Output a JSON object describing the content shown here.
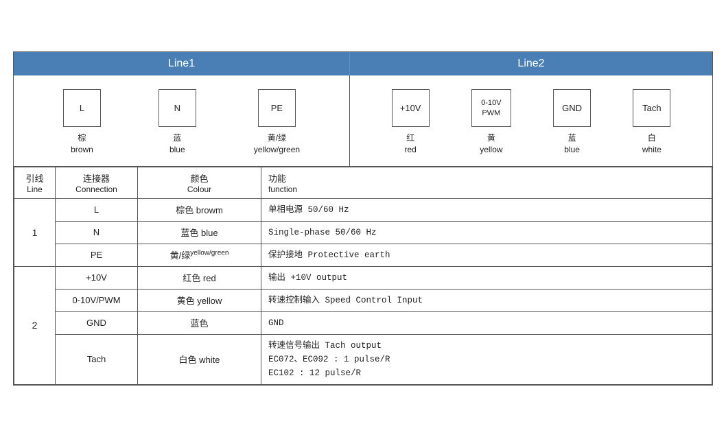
{
  "header": {
    "line1_label": "Line1",
    "line2_label": "Line2"
  },
  "diagram": {
    "line1_connectors": [
      {
        "label": "L",
        "zh": "棕",
        "en": "brown"
      },
      {
        "label": "N",
        "zh": "蓝",
        "en": "blue"
      },
      {
        "label": "PE",
        "zh": "黄/绿",
        "en": "yellow/green"
      }
    ],
    "line2_connectors": [
      {
        "label": "+10V",
        "zh": "红",
        "en": "red"
      },
      {
        "label": "0-10V\nPWM",
        "zh": "黄",
        "en": "yellow"
      },
      {
        "label": "GND",
        "zh": "蓝",
        "en": "blue"
      },
      {
        "label": "Tach",
        "zh": "白",
        "en": "white"
      }
    ]
  },
  "table": {
    "headers": {
      "line_zh": "引线",
      "line_en": "Line",
      "conn_zh": "连接器",
      "conn_en": "Connection",
      "colour_zh": "颜色",
      "colour_en": "Colour",
      "func_zh": "功能",
      "func_en": "function"
    },
    "rows": [
      {
        "line": "1",
        "line_rowspan": 3,
        "entries": [
          {
            "conn": "L",
            "colour_zh": "棕色",
            "colour_en": "browm",
            "func": "单相电源 50/60 Hz"
          },
          {
            "conn": "N",
            "colour_zh": "蓝色",
            "colour_en": "blue",
            "func": "Single-phase 50/60 Hz"
          },
          {
            "conn": "PE",
            "colour_zh": "黄/绿",
            "colour_en": "yellow/green",
            "func": "保护接地 Protective earth"
          }
        ]
      },
      {
        "line": "2",
        "line_rowspan": 4,
        "entries": [
          {
            "conn": "+10V",
            "colour_zh": "红色",
            "colour_en": "red",
            "func": "输出 +10V output"
          },
          {
            "conn": "0-10V/PWM",
            "colour_zh": "黄色",
            "colour_en": "yellow",
            "func": "转速控制输入 Speed Control Input"
          },
          {
            "conn": "GND",
            "colour_zh": "蓝色",
            "colour_en": "",
            "func": "GND"
          },
          {
            "conn": "Tach",
            "colour_zh": "白色",
            "colour_en": "white",
            "func_lines": [
              "转速信号输出 Tach output",
              "EC072、EC092 : 1 pulse/R",
              "EC102 : 12 pulse/R"
            ]
          }
        ]
      }
    ]
  }
}
